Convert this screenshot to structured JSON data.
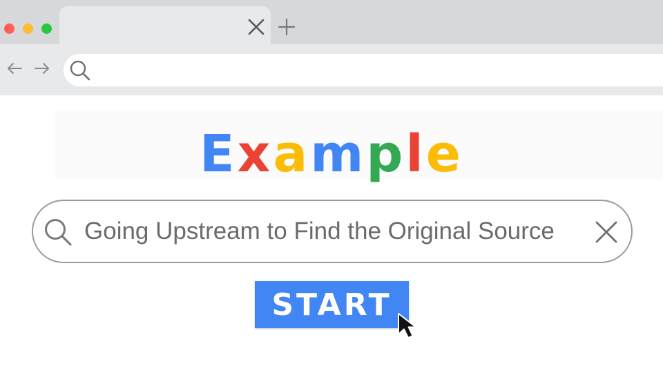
{
  "window": {
    "controls": [
      {
        "name": "close-window",
        "color": "#ff5f57"
      },
      {
        "name": "minimize-window",
        "color": "#febc2e"
      },
      {
        "name": "maximize-window",
        "color": "#28c840"
      }
    ],
    "tab": {
      "title": "",
      "close_icon": "close-icon"
    },
    "new_tab_icon": "plus-icon"
  },
  "toolbar": {
    "back_icon": "arrow-left-icon",
    "forward_icon": "arrow-right-icon",
    "address": {
      "value": "",
      "placeholder": "",
      "icon": "search-icon"
    }
  },
  "logo": {
    "letters": [
      {
        "char": "E",
        "color": "#4285f4"
      },
      {
        "char": "x",
        "color": "#ea4335"
      },
      {
        "char": "a",
        "color": "#fbbc05"
      },
      {
        "char": "m",
        "color": "#4285f4"
      },
      {
        "char": "p",
        "color": "#34a853"
      },
      {
        "char": "l",
        "color": "#ea4335"
      },
      {
        "char": "e",
        "color": "#fbbc05"
      }
    ]
  },
  "search": {
    "query": "Going Upstream to Find the Original Source",
    "icon": "search-icon",
    "clear_icon": "close-icon"
  },
  "start_button": {
    "label": "START",
    "color": "#4285f4"
  },
  "pointer": {
    "icon": "mouse-pointer-icon"
  }
}
